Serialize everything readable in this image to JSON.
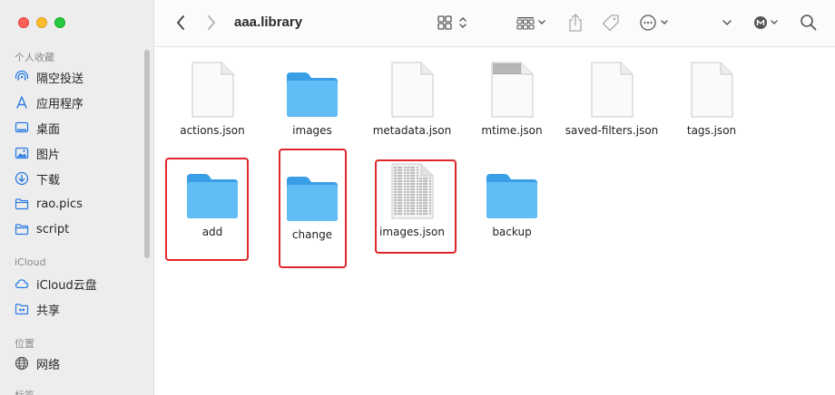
{
  "window": {
    "title": "aaa.library"
  },
  "sidebar": {
    "favorites_header": "个人收藏",
    "favorites": [
      {
        "label": "隔空投送",
        "icon": "airdrop-icon"
      },
      {
        "label": "应用程序",
        "icon": "applications-icon"
      },
      {
        "label": "桌面",
        "icon": "desktop-icon"
      },
      {
        "label": "图片",
        "icon": "pictures-icon"
      },
      {
        "label": "下载",
        "icon": "downloads-icon"
      },
      {
        "label": "rao.pics",
        "icon": "folder-icon"
      },
      {
        "label": "script",
        "icon": "folder-icon"
      }
    ],
    "icloud_header": "iCloud",
    "icloud": [
      {
        "label": "iCloud云盘",
        "icon": "icloud-icon"
      },
      {
        "label": "共享",
        "icon": "shared-folder-icon"
      }
    ],
    "locations_header": "位置",
    "locations": [
      {
        "label": "网络",
        "icon": "network-icon"
      }
    ],
    "tags_header": "标签"
  },
  "toolbar": {
    "back": "chevron-left-icon",
    "forward": "chevron-right-icon",
    "view": "icon-grid-view-icon",
    "group": "group-by-icon",
    "share": "share-icon",
    "tag": "tag-icon",
    "more": "more-actions-icon",
    "dropdown": "chevron-down-icon",
    "extension": "extension-icon",
    "search": "search-icon"
  },
  "files": [
    {
      "name": "actions.json",
      "kind": "document"
    },
    {
      "name": "images",
      "kind": "folder"
    },
    {
      "name": "metadata.json",
      "kind": "document"
    },
    {
      "name": "mtime.json",
      "kind": "document-preview"
    },
    {
      "name": "saved-filters.json",
      "kind": "document"
    },
    {
      "name": "tags.json",
      "kind": "document"
    },
    {
      "name": "add",
      "kind": "folder",
      "highlighted": true
    },
    {
      "name": "change",
      "kind": "folder",
      "highlighted": true
    },
    {
      "name": "images.json",
      "kind": "document-preview",
      "highlighted": true
    },
    {
      "name": "backup",
      "kind": "folder"
    }
  ],
  "colors": {
    "highlight": "#e0262b",
    "folder": "#5fb8f3",
    "sidebar_bg": "#ededed",
    "sidebar_icon": "#2a7be4"
  }
}
